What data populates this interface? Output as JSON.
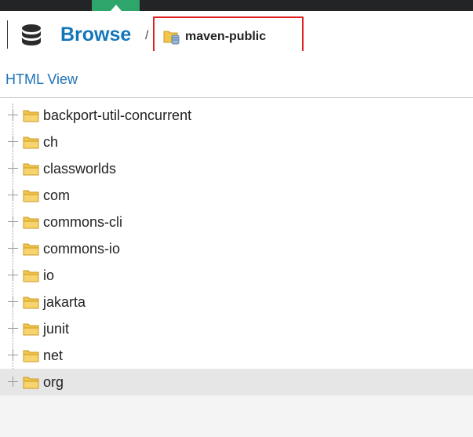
{
  "header": {
    "title": "Browse",
    "separator": "/",
    "repository": "maven-public"
  },
  "content": {
    "html_view_link": "HTML View"
  },
  "tree": {
    "items": [
      {
        "label": "backport-util-concurrent",
        "selected": false
      },
      {
        "label": "ch",
        "selected": false
      },
      {
        "label": "classworlds",
        "selected": false
      },
      {
        "label": "com",
        "selected": false
      },
      {
        "label": "commons-cli",
        "selected": false
      },
      {
        "label": "commons-io",
        "selected": false
      },
      {
        "label": "io",
        "selected": false
      },
      {
        "label": "jakarta",
        "selected": false
      },
      {
        "label": "junit",
        "selected": false
      },
      {
        "label": "net",
        "selected": false
      },
      {
        "label": "org",
        "selected": true
      }
    ]
  },
  "icons": {
    "header": "database-icon",
    "repository": "repository-folder-icon",
    "tree_item": "folder-icon",
    "expander": "expand-plus-icon"
  },
  "colors": {
    "accent_green": "#2ea56a",
    "title_blue": "#1476ba",
    "link_blue": "#1f72b8",
    "highlight_red": "#e02020",
    "folder_yellow": "#f2c54b"
  }
}
